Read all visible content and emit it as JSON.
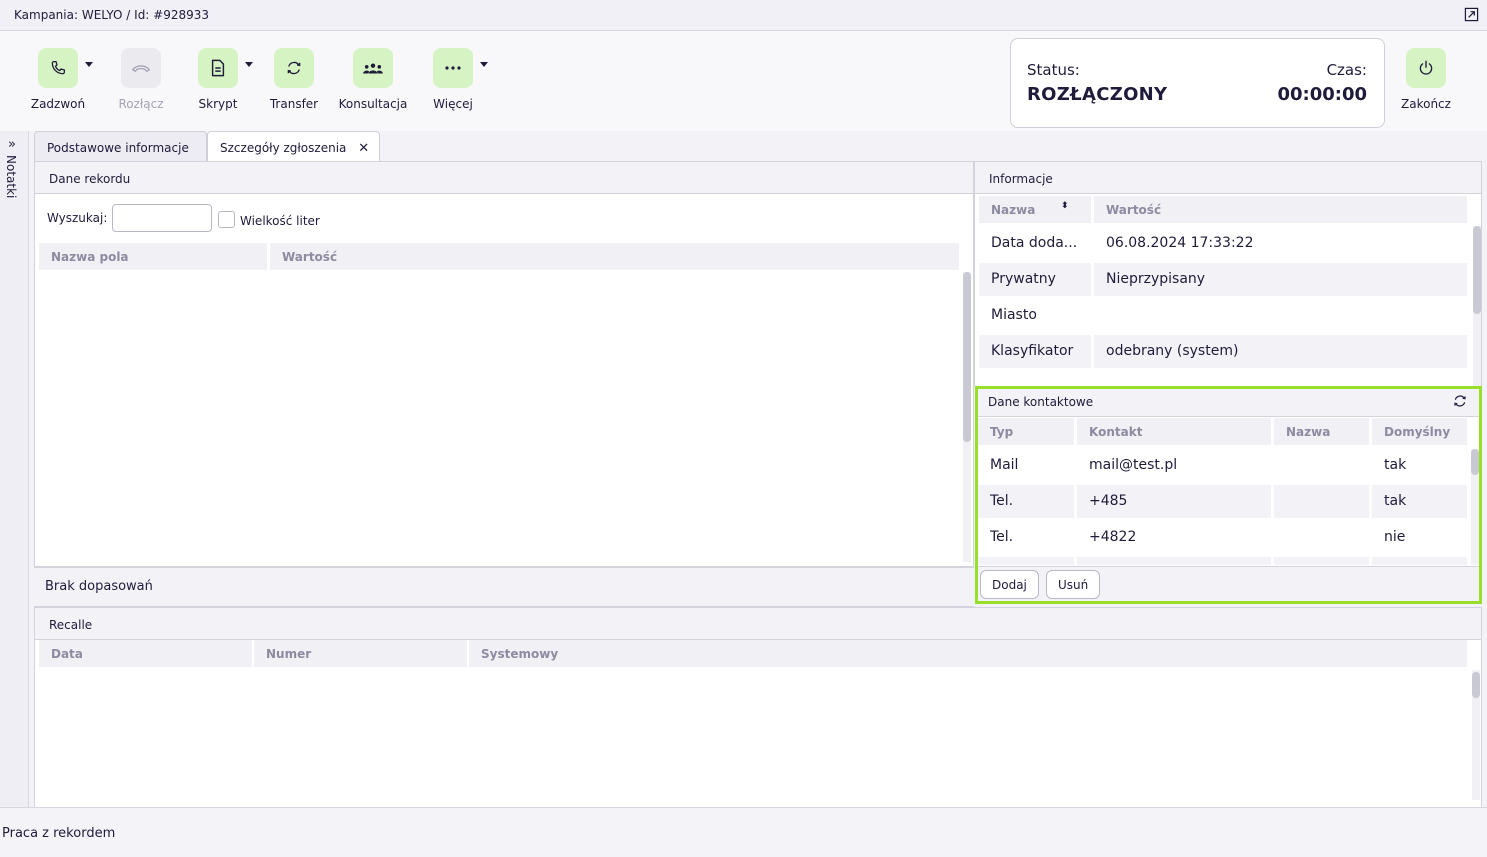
{
  "window": {
    "title": "Kampania: WELYO / Id: #928933"
  },
  "toolbar": {
    "call": "Zadzwoń",
    "hangup": "Rozłącz",
    "script": "Skrypt",
    "transfer": "Transfer",
    "consult": "Konsultacja",
    "more": "Więcej",
    "finish": "Zakończ"
  },
  "status": {
    "label": "Status:",
    "value": "ROZŁĄCZONY",
    "time_label": "Czas:",
    "time_value": "00:00:00"
  },
  "side": {
    "notes": "Notatki"
  },
  "tabs": [
    {
      "label": "Podstawowe informacje"
    },
    {
      "label": "Szczegóły zgłoszenia"
    }
  ],
  "record": {
    "title": "Dane rekordu",
    "search_label": "Wyszukaj:",
    "case_label": "Wielkość liter",
    "columns": [
      "Nazwa pola",
      "Wartość"
    ],
    "no_match": "Brak dopasowań"
  },
  "info": {
    "title": "Informacje",
    "columns": [
      "Nazwa",
      "Wartość"
    ],
    "rows": [
      {
        "name": "Data doda...",
        "value": "06.08.2024 17:33:22"
      },
      {
        "name": "Prywatny",
        "value": "Nieprzypisany"
      },
      {
        "name": "Miasto",
        "value": ""
      },
      {
        "name": "Klasyfikator",
        "value": "odebrany (system)"
      }
    ]
  },
  "contacts": {
    "title": "Dane kontaktowe",
    "columns": [
      "Typ",
      "Kontakt",
      "Nazwa",
      "Domyślny"
    ],
    "rows": [
      {
        "type": "Mail",
        "contact": "mail@test.pl",
        "name": "",
        "default": "tak"
      },
      {
        "type": "Tel.",
        "contact": "+485",
        "name": "",
        "default": "tak"
      },
      {
        "type": "Tel.",
        "contact": "+4822",
        "name": "",
        "default": "nie"
      }
    ],
    "add": "Dodaj",
    "remove": "Usuń"
  },
  "recalls": {
    "title": "Recalle",
    "columns": [
      "Data",
      "Numer",
      "Systemowy"
    ]
  },
  "footer": {
    "text": "Praca z rekordem"
  }
}
